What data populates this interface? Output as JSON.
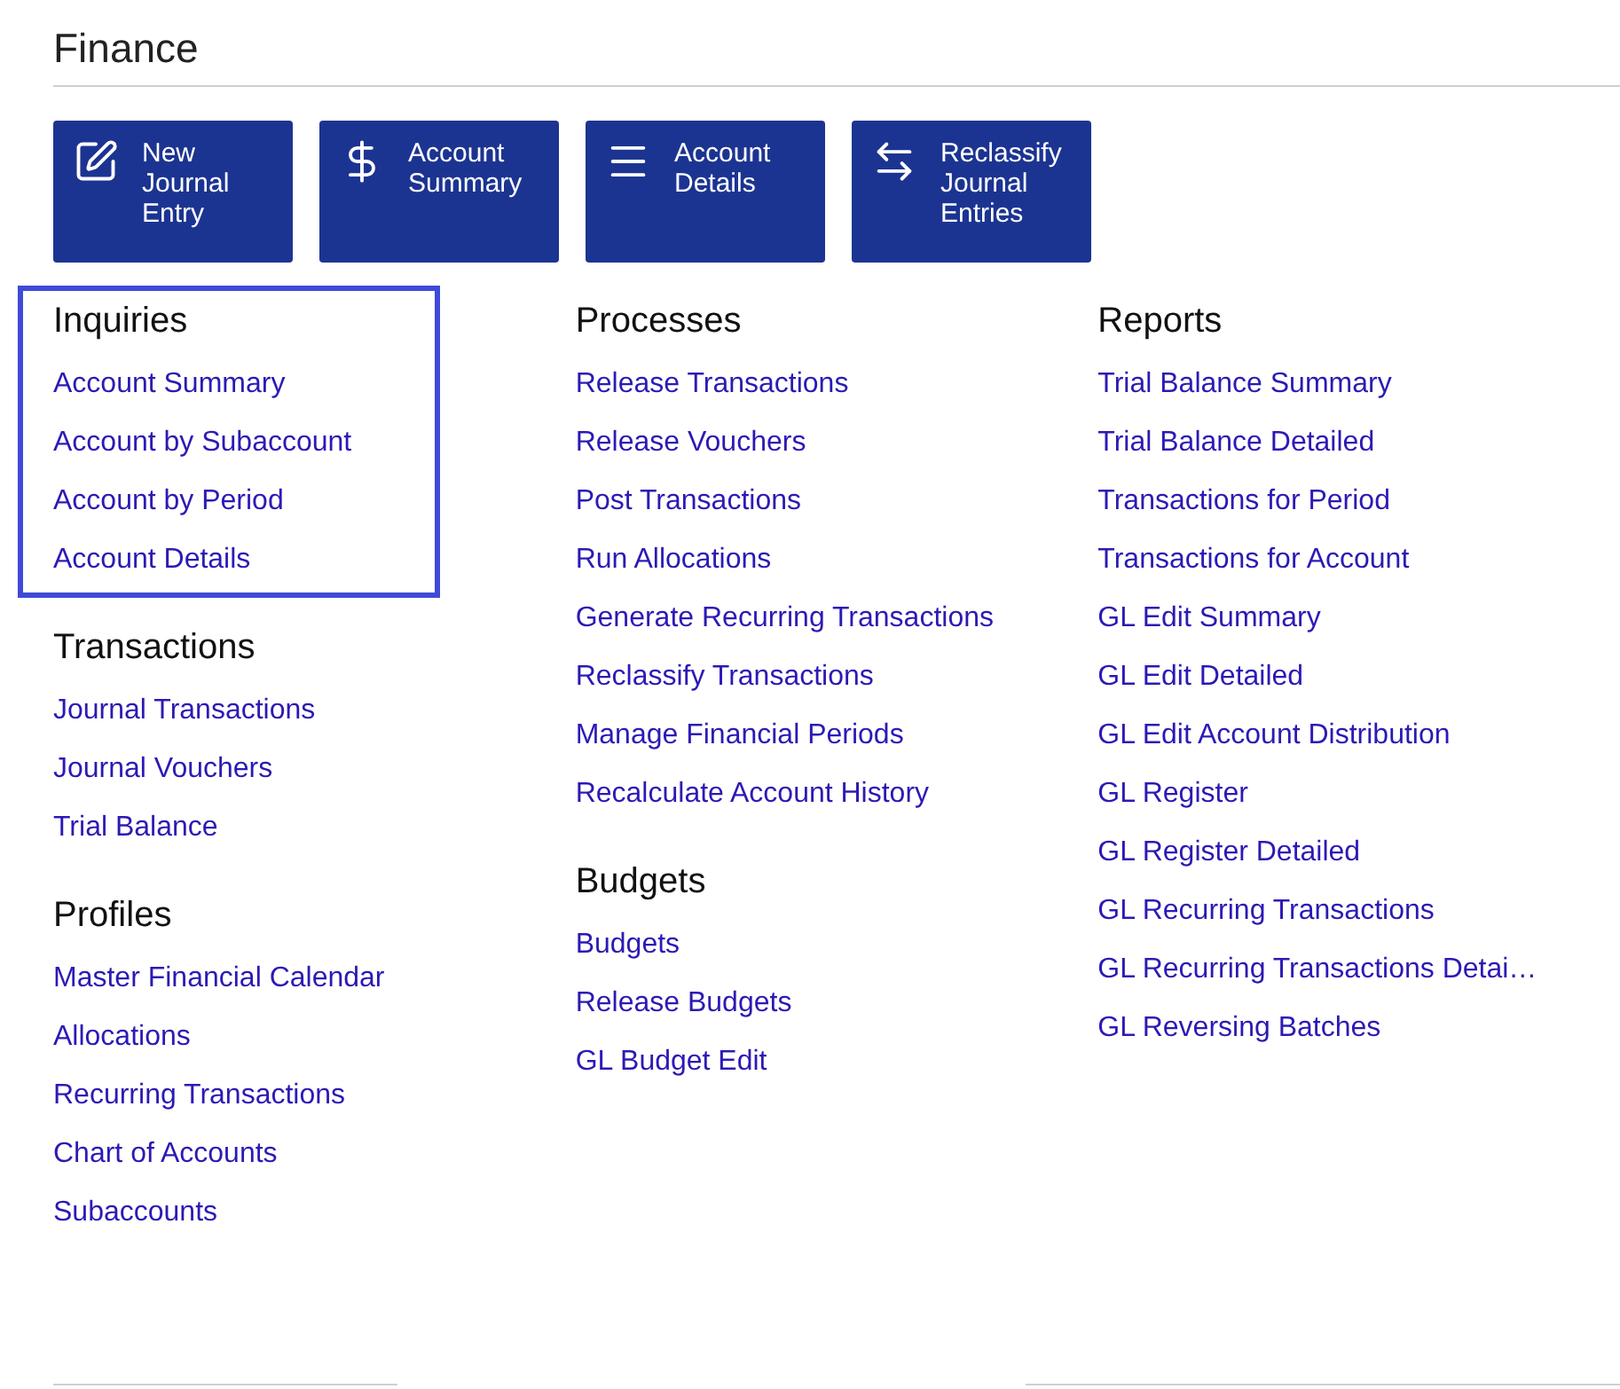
{
  "title": "Finance",
  "tiles": [
    {
      "label": "New Journal Entry",
      "kind": "edit"
    },
    {
      "label": "Account Summary",
      "kind": "dollar"
    },
    {
      "label": "Account Details",
      "kind": "menu"
    },
    {
      "label": "Reclassify Journal Entries",
      "kind": "swap"
    }
  ],
  "columns": [
    {
      "sections": [
        {
          "heading": "Inquiries",
          "highlighted": true,
          "links": [
            "Account Summary",
            "Account by Subaccount",
            "Account by Period",
            "Account Details"
          ]
        },
        {
          "heading": "Transactions",
          "highlighted": false,
          "links": [
            "Journal Transactions",
            "Journal Vouchers",
            "Trial Balance"
          ]
        },
        {
          "heading": "Profiles",
          "highlighted": false,
          "links": [
            "Master Financial Calendar",
            "Allocations",
            "Recurring Transactions",
            "Chart of Accounts",
            "Subaccounts"
          ]
        }
      ]
    },
    {
      "sections": [
        {
          "heading": "Processes",
          "highlighted": false,
          "links": [
            "Release Transactions",
            "Release Vouchers",
            "Post Transactions",
            "Run Allocations",
            "Generate Recurring Transactions",
            "Reclassify Transactions",
            "Manage Financial Periods",
            "Recalculate Account History"
          ]
        },
        {
          "heading": "Budgets",
          "highlighted": false,
          "links": [
            "Budgets",
            "Release Budgets",
            "GL Budget Edit"
          ]
        }
      ]
    },
    {
      "sections": [
        {
          "heading": "Reports",
          "highlighted": false,
          "links": [
            "Trial Balance Summary",
            "Trial Balance Detailed",
            "Transactions for Period",
            "Transactions for Account",
            "GL Edit Summary",
            "GL Edit Detailed",
            "GL Edit Account Distribution",
            "GL Register",
            "GL Register Detailed",
            "GL Recurring Transactions",
            "GL Recurring Transactions Detai…",
            "GL Reversing Batches"
          ]
        }
      ]
    }
  ]
}
